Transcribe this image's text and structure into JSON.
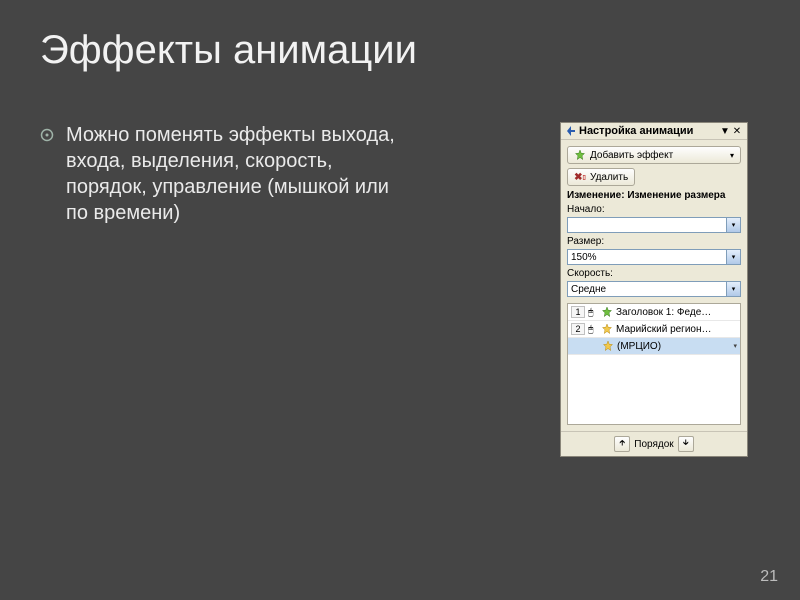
{
  "slide": {
    "title": "Эффекты анимации",
    "bullet": "Можно поменять эффекты выхода, входа, выделения, скорость, порядок, управление (мышкой или по времени)",
    "page_number": "21"
  },
  "panel": {
    "title": "Настройка анимации",
    "add_effect": "Добавить эффект",
    "remove": "Удалить",
    "change_header": "Изменение: Изменение размера",
    "start_label": "Начало:",
    "start_value": "",
    "size_label": "Размер:",
    "size_value": "150%",
    "speed_label": "Скорость:",
    "speed_value": "Средне",
    "order_label": "Порядок",
    "effects": [
      {
        "order": "1",
        "trigger": "🖱",
        "icon": "green-star",
        "label": "Заголовок 1: Феде…"
      },
      {
        "order": "2",
        "trigger": "🖱",
        "icon": "yellow-star",
        "label": "Марийский регион…"
      },
      {
        "order": "",
        "trigger": "",
        "icon": "yellow-star",
        "label": "(МРЦИО)",
        "indent": true,
        "selected": true
      }
    ]
  }
}
